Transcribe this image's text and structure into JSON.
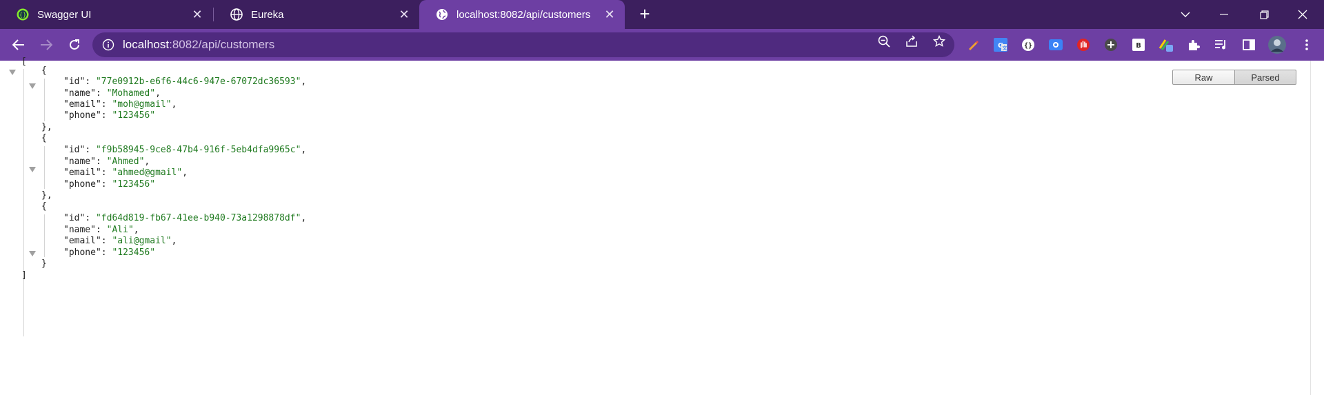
{
  "tabs": [
    {
      "title": "Swagger UI",
      "icon": "swagger-icon",
      "active": false
    },
    {
      "title": "Eureka",
      "icon": "globe-icon",
      "active": false
    },
    {
      "title": "localhost:8082/api/customers",
      "icon": "globe-icon",
      "active": true
    }
  ],
  "toolbar": {
    "url_host": "localhost",
    "url_path": ":8082/api/customers"
  },
  "viewer": {
    "raw_label": "Raw",
    "parsed_label": "Parsed",
    "selected": "Parsed"
  },
  "customers": [
    {
      "id": "77e0912b-e6f6-44c6-947e-67072dc36593",
      "name": "Mohamed",
      "email": "moh@gmail",
      "phone": "123456"
    },
    {
      "id": "f9b58945-9ce8-47b4-916f-5eb4dfa9965c",
      "name": "Ahmed",
      "email": "ahmed@gmail",
      "phone": "123456"
    },
    {
      "id": "fd64d819-fb67-41ee-b940-73a1298878df",
      "name": "Ali",
      "email": "ali@gmail",
      "phone": "123456"
    }
  ],
  "colors": {
    "tabstrip": "#3c1f5e",
    "toolbar": "#6d3fa3",
    "json_string": "#1f7a1f"
  }
}
